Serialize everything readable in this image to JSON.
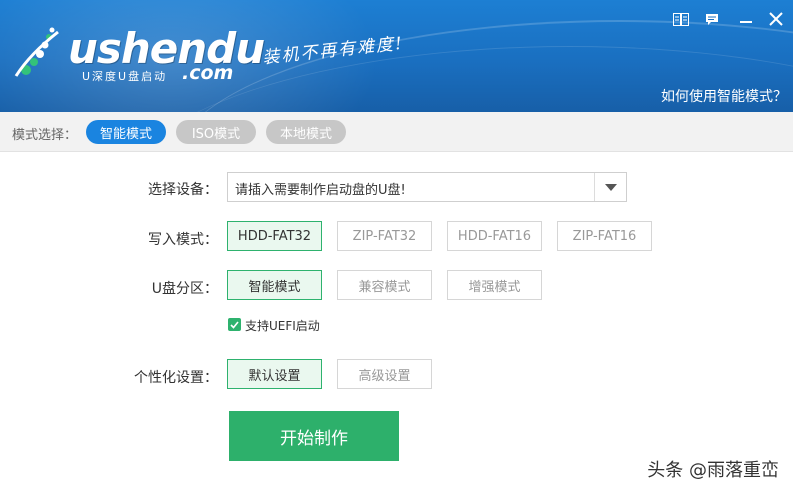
{
  "header": {
    "logo_text": "ushendu",
    "logo_subtitle": "U深度U盘启动",
    "logo_domain": ".com",
    "slogan": "装机不再有难度!",
    "help_link": "如何使用智能模式？",
    "icons": [
      "manual-book-icon",
      "feedback-icon",
      "minimize-icon",
      "close-icon"
    ]
  },
  "modebar": {
    "label": "模式选择：",
    "modes": [
      {
        "label": "智能模式",
        "active": true
      },
      {
        "label": "ISO模式",
        "active": false
      },
      {
        "label": "本地模式",
        "active": false
      }
    ]
  },
  "form": {
    "device": {
      "label": "选择设备：",
      "value": "请插入需要制作启动盘的U盘!"
    },
    "write_mode": {
      "label": "写入模式：",
      "options": [
        "HDD-FAT32",
        "ZIP-FAT32",
        "HDD-FAT16",
        "ZIP-FAT16"
      ],
      "selected": "HDD-FAT32"
    },
    "partition": {
      "label": "U盘分区：",
      "options": [
        "智能模式",
        "兼容模式",
        "增强模式"
      ],
      "selected": "智能模式"
    },
    "uefi": {
      "label": "支持UEFI启动",
      "checked": true
    },
    "personalize": {
      "label": "个性化设置：",
      "options": [
        "默认设置",
        "高级设置"
      ],
      "selected": "默认设置"
    },
    "start_button": "开始制作"
  },
  "watermark": "头条 @雨落重峦",
  "colors": {
    "header_blue": "#1a6fc0",
    "active_pill": "#1a84e0",
    "accent_green": "#2db06b",
    "selected_bg": "#eaf8ef"
  }
}
